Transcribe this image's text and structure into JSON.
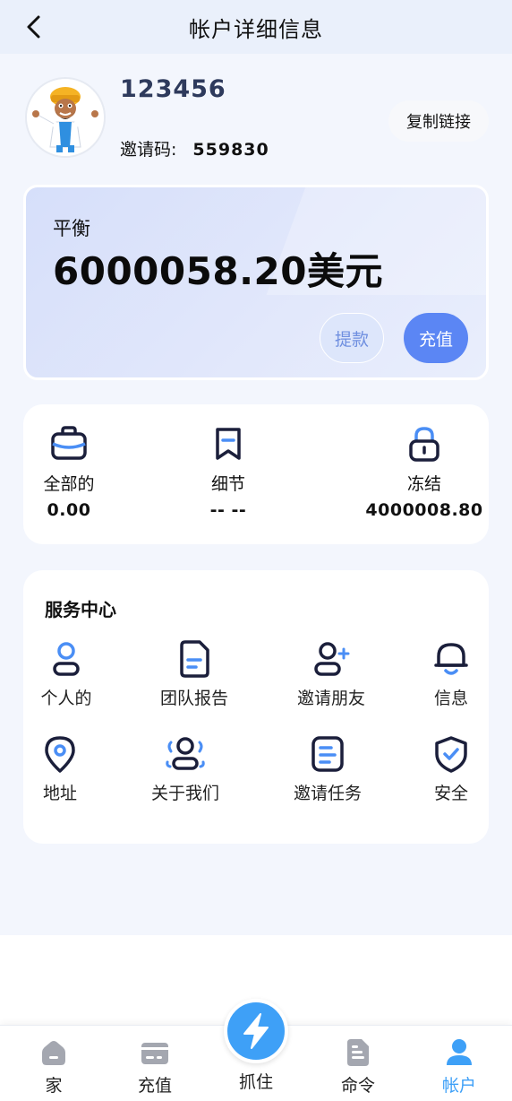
{
  "header": {
    "title": "帐户详细信息"
  },
  "profile": {
    "user_id": "123456",
    "invite_label": "邀请码:",
    "invite_code": "559830",
    "copy_button": "复制链接"
  },
  "balance": {
    "label": "平衡",
    "value": "6000058.20美元",
    "withdraw_button": "提款",
    "recharge_button": "充值"
  },
  "stats": [
    {
      "label": "全部的",
      "value": "0.00",
      "icon": "briefcase-icon"
    },
    {
      "label": "细节",
      "value": "-- --",
      "icon": "bookmark-icon"
    },
    {
      "label": "冻结",
      "value": "4000008.80",
      "icon": "lock-icon"
    }
  ],
  "service": {
    "title": "服务中心",
    "items": [
      {
        "label": "个人的",
        "icon": "user-icon"
      },
      {
        "label": "团队报告",
        "icon": "document-icon"
      },
      {
        "label": "邀请朋友",
        "icon": "add-user-icon"
      },
      {
        "label": "信息",
        "icon": "bell-icon"
      },
      {
        "label": "地址",
        "icon": "location-pin-icon"
      },
      {
        "label": "关于我们",
        "icon": "group-icon"
      },
      {
        "label": "邀请任务",
        "icon": "task-list-icon"
      },
      {
        "label": "安全",
        "icon": "shield-check-icon"
      }
    ]
  },
  "nav": {
    "items": [
      {
        "label": "家",
        "icon": "home-icon"
      },
      {
        "label": "充值",
        "icon": "card-icon"
      },
      {
        "label": "抓住",
        "icon": "lightning-icon"
      },
      {
        "label": "命令",
        "icon": "order-file-icon"
      },
      {
        "label": "帐户",
        "icon": "account-icon",
        "active": true
      }
    ],
    "active_color": "#3ea0f7",
    "inactive_color": "#a4a7b0"
  },
  "colors": {
    "accent": "#5b86f4",
    "nav_active": "#3ea0f7",
    "icon_dark": "#1b1f3b",
    "icon_blue": "#4a8ef5"
  }
}
